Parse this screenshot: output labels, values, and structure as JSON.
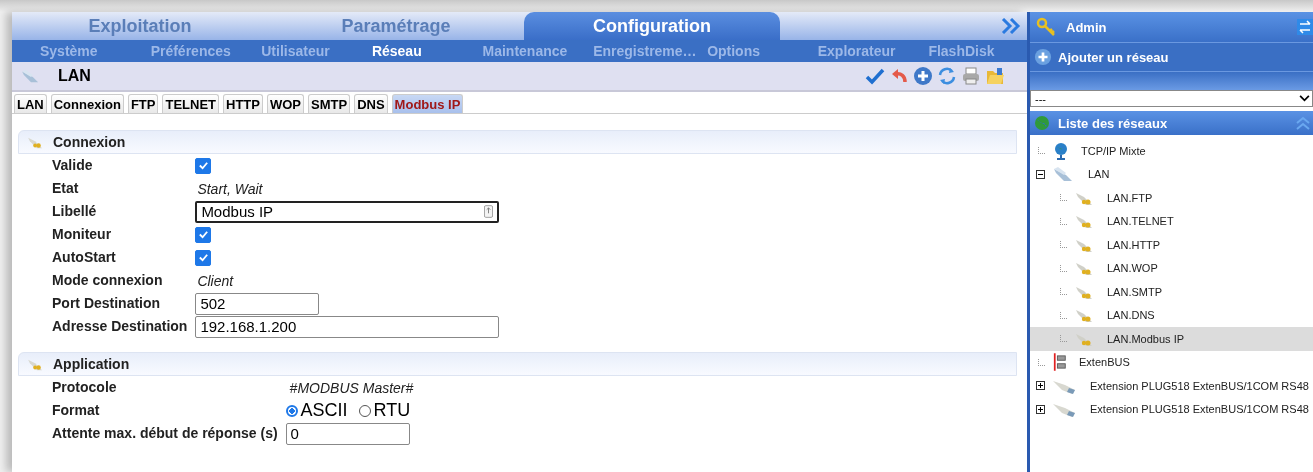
{
  "main_tabs": [
    {
      "label": "Exploitation",
      "selected": false
    },
    {
      "label": "Paramétrage",
      "selected": false
    },
    {
      "label": "Configuration",
      "selected": true
    }
  ],
  "sub_menu": [
    {
      "label": "Système",
      "selected": false
    },
    {
      "label": "Préférences",
      "selected": false
    },
    {
      "label": "Utilisateur",
      "selected": false
    },
    {
      "label": "Réseau",
      "selected": true
    },
    {
      "label": "Maintenance",
      "selected": false
    },
    {
      "label": "Enregistreme…",
      "selected": false
    },
    {
      "label": "Options",
      "selected": false
    },
    {
      "label": "Explorateur",
      "selected": false
    },
    {
      "label": "FlashDisk",
      "selected": false
    }
  ],
  "page_title": "LAN",
  "protocol_tabs": [
    {
      "label": "LAN",
      "selected": false
    },
    {
      "label": "Connexion",
      "selected": false
    },
    {
      "label": "FTP",
      "selected": false
    },
    {
      "label": "TELNET",
      "selected": false
    },
    {
      "label": "HTTP",
      "selected": false
    },
    {
      "label": "WOP",
      "selected": false
    },
    {
      "label": "SMTP",
      "selected": false
    },
    {
      "label": "DNS",
      "selected": false
    },
    {
      "label": "Modbus IP",
      "selected": true
    }
  ],
  "sections": [
    {
      "title": "Connexion",
      "fields": [
        {
          "kind": "checkbox",
          "label": "Valide",
          "checked": true
        },
        {
          "kind": "readout",
          "label": "Etat",
          "value": "Start, Wait"
        },
        {
          "kind": "label-input",
          "label": "Libellé",
          "value": "Modbus IP"
        },
        {
          "kind": "checkbox",
          "label": "Moniteur",
          "checked": true
        },
        {
          "kind": "checkbox",
          "label": "AutoStart",
          "checked": true
        },
        {
          "kind": "readout",
          "label": "Mode connexion",
          "value": "Client"
        },
        {
          "kind": "short-input",
          "label": "Port Destination",
          "value": "502"
        },
        {
          "kind": "input",
          "label": "Adresse Destination",
          "value": "192.168.1.200"
        }
      ]
    },
    {
      "title": "Application",
      "fields": [
        {
          "kind": "readout",
          "label": "Protocole",
          "value": "#MODBUS Master#"
        },
        {
          "kind": "radio",
          "label": "Format",
          "options": [
            {
              "label": "ASCII",
              "selected": true
            },
            {
              "label": "RTU",
              "selected": false
            }
          ]
        },
        {
          "kind": "short-input",
          "label": "Attente max. début de réponse (s)",
          "value": "0"
        }
      ]
    }
  ],
  "user": "Admin",
  "add_network": "Ajouter un réseau",
  "network_select": {
    "value": "---"
  },
  "tree": {
    "title": "Liste des réseaux",
    "items": [
      {
        "label": "TCP/IP Mixte",
        "kind": "globe",
        "selected": false
      },
      {
        "label": "LAN",
        "kind": "lan",
        "selected": false,
        "expanded": true,
        "children": [
          {
            "label": "LAN.FTP",
            "kind": "plug",
            "selected": false
          },
          {
            "label": "LAN.TELNET",
            "kind": "plug",
            "selected": false
          },
          {
            "label": "LAN.HTTP",
            "kind": "plug",
            "selected": false
          },
          {
            "label": "LAN.WOP",
            "kind": "plug",
            "selected": false
          },
          {
            "label": "LAN.SMTP",
            "kind": "plug",
            "selected": false
          },
          {
            "label": "LAN.DNS",
            "kind": "plug",
            "selected": false
          },
          {
            "label": "LAN.Modbus IP",
            "kind": "plug",
            "selected": true
          }
        ]
      },
      {
        "label": "ExtenBUS",
        "kind": "bus",
        "selected": false
      },
      {
        "label": "Extension PLUG518 ExtenBUS/1COM RS48",
        "kind": "serial",
        "selected": false,
        "expanded": false
      },
      {
        "label": "Extension PLUG518 ExtenBUS/1COM RS48",
        "kind": "serial",
        "selected": false,
        "expanded": false
      }
    ]
  }
}
